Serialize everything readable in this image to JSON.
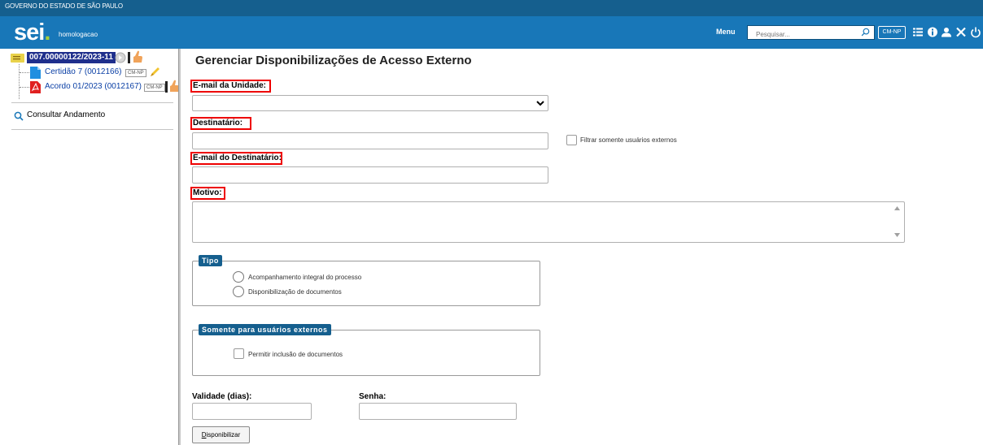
{
  "header": {
    "gov_label": "GOVERNO DO ESTADO DE SÃO PAULO",
    "logo_text": "sei",
    "logo_dot": ".",
    "environment": "homologacao",
    "menu_label": "Menu",
    "search_placeholder": "Pesquisar...",
    "unit_button": "CM-NP",
    "icons": [
      "search-icon",
      "list-icon",
      "info-icon",
      "user-icon",
      "tools-icon",
      "power-icon"
    ],
    "colors": {
      "gov_bar": "#155f8e",
      "top_bar": "#1877b8",
      "logo_dot": "#a6cf3a"
    }
  },
  "tree": {
    "process_number": "007.00000122/2023-11",
    "documents": [
      {
        "label": "Certidão 7 (0012166)",
        "badge": "CM-NP",
        "icon": "word-doc-icon",
        "marker": "pencil-icon"
      },
      {
        "label": "Acordo 01/2023 (0012167)",
        "badge": "CM-NP",
        "icon": "pdf-doc-icon",
        "marker": "hand-icon"
      }
    ],
    "consult_label": "Consultar Andamento"
  },
  "form": {
    "title": "Gerenciar Disponibilizações de Acesso Externo",
    "email_unidade_label": "E-mail da Unidade:",
    "email_unidade_value": "",
    "destinatario_label": "Destinatário:",
    "destinatario_value": "",
    "filtrar_label": "Filtrar somente usuários externos",
    "email_destinatario_label": "E-mail do Destinatário:",
    "email_destinatario_value": "",
    "motivo_label": "Motivo:",
    "motivo_value": "",
    "tipo_legend": "Tipo",
    "tipo_options": [
      "Acompanhamento integral do processo",
      "Disponibilização de documentos"
    ],
    "externos_legend": "Somente para usuários externos",
    "permitir_label": "Permitir inclusão de documentos",
    "validade_label": "Validade (dias):",
    "validade_value": "",
    "senha_label": "Senha:",
    "senha_value": "",
    "button_first_letter": "D",
    "button_rest": "isponibilizar",
    "highlight_color": "#e00000"
  }
}
